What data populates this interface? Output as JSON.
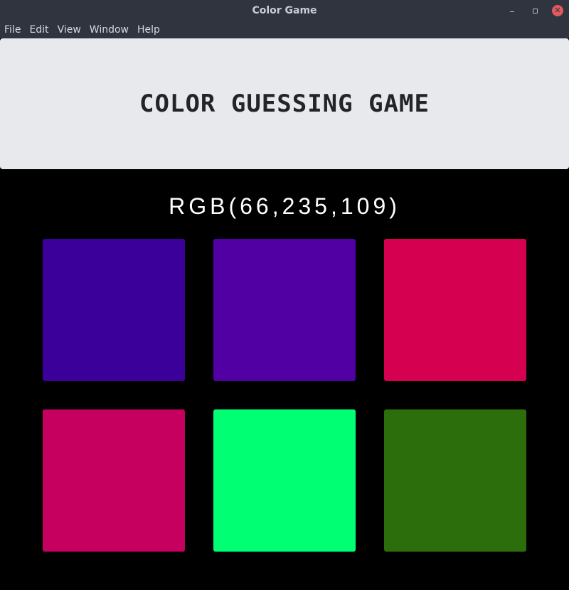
{
  "window": {
    "title": "Color Game"
  },
  "menubar": {
    "items": [
      "File",
      "Edit",
      "View",
      "Window",
      "Help"
    ]
  },
  "header": {
    "title": "COLOR GUESSING GAME"
  },
  "target": {
    "rgb_text": "RGB(66,235,109)"
  },
  "swatches": [
    {
      "color": "#3b0099"
    },
    {
      "color": "#5000a3"
    },
    {
      "color": "#d60051"
    },
    {
      "color": "#c5005e"
    },
    {
      "color": "#00ff73"
    },
    {
      "color": "#2d6e0c"
    }
  ]
}
